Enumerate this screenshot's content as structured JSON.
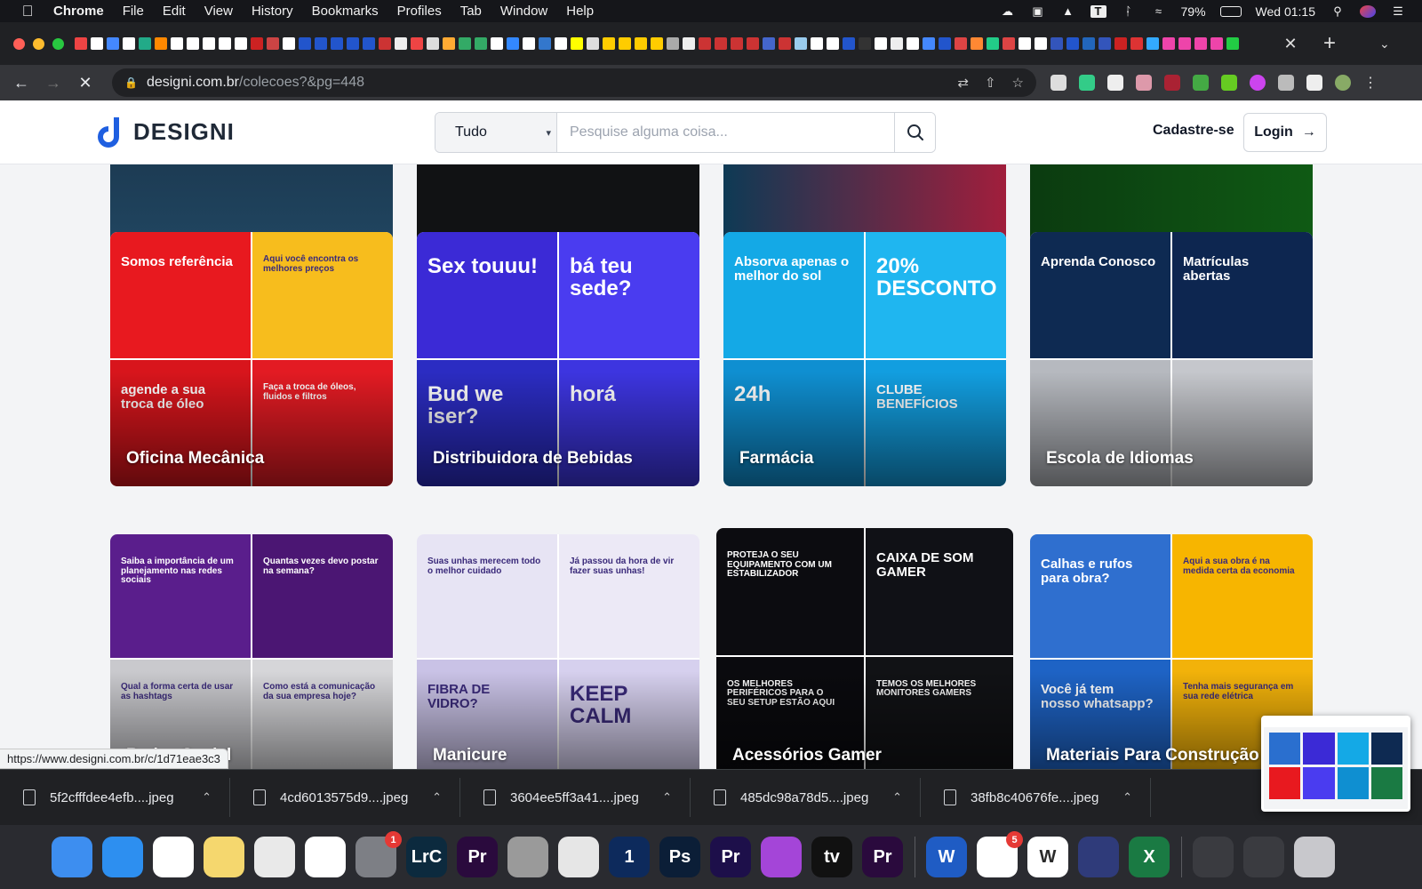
{
  "menubar": {
    "app": "Chrome",
    "items": [
      "File",
      "Edit",
      "View",
      "History",
      "Bookmarks",
      "Profiles",
      "Tab",
      "Window",
      "Help"
    ],
    "battery": "79%",
    "clock": "Wed 01:15"
  },
  "browser": {
    "url_host": "designi.com.br",
    "url_path": "/colecoes?&pg=448",
    "status_url": "https://www.designi.com.br/c/1d71eae3c3"
  },
  "site": {
    "logo_text": "DESIGNI",
    "search_category": "Tudo",
    "search_placeholder": "Pesquise alguma coisa...",
    "signup": "Cadastre-se",
    "login": "Login"
  },
  "collections": [
    {
      "title": "Oficina Mecânica",
      "colors": [
        "#e8191f",
        "#f7bd1d",
        "#d8151c",
        "#e31b23"
      ],
      "texts": [
        "Somos referência",
        "Aqui você encontra os melhores preços",
        "agende a sua troca de óleo",
        "Faça a troca de óleos, fluidos e filtros"
      ]
    },
    {
      "title": "Distribuidora de Bebidas",
      "colors": [
        "#3b2ad6",
        "#4a3cf0",
        "#2b2cc2",
        "#3d35e0"
      ],
      "texts": [
        "Sex touuu!",
        "bá teu sede?",
        "Bud we iser?",
        "horá"
      ]
    },
    {
      "title": "Farmácia",
      "colors": [
        "#14a9e6",
        "#1fb6f0",
        "#0f8fd1",
        "#129ee0"
      ],
      "texts": [
        "Absorva apenas o melhor do sol",
        "20% DESCONTO",
        "24h",
        "CLUBE BENEFÍCIOS"
      ]
    },
    {
      "title": "Escola de Idiomas",
      "colors": [
        "#0e2a52",
        "#0d2650",
        "#b6b9bf",
        "#c5c7cc"
      ],
      "texts": [
        "Aprenda Conosco",
        "Matrículas abertas",
        "",
        ""
      ]
    },
    {
      "title": "Redes Social",
      "colors": [
        "#5a1e8c",
        "#4b1673",
        "#c9c9cd",
        "#d6d6d9"
      ],
      "texts": [
        "Saiba a importância de um planejamento nas redes sociais",
        "Quantas vezes devo postar na semana?",
        "Qual a forma certa de usar as hashtags",
        "Como está a comunicação da sua empresa hoje?"
      ]
    },
    {
      "title": "Manicure",
      "colors": [
        "#e7e4f4",
        "#ece9f6",
        "#c9c2e6",
        "#d6d0ee"
      ],
      "texts": [
        "Suas unhas merecem todo o melhor cuidado",
        "Já passou da hora de vir fazer suas unhas!",
        "FIBRA DE VIDRO?",
        "KEEP CALM"
      ]
    },
    {
      "title": "Acessórios Gamer",
      "colors": [
        "#0c0c10",
        "#101116",
        "#0a0a0e",
        "#111215"
      ],
      "texts": [
        "PROTEJA O SEU EQUIPAMENTO COM UM ESTABILIZADOR",
        "CAIXA DE SOM GAMER",
        "OS MELHORES PERIFÉRICOS PARA O SEU SETUP ESTÃO AQUI",
        "TEMOS OS MELHORES MONITORES GAMERS"
      ]
    },
    {
      "title": "Materiais Para Construção",
      "colors": [
        "#2f6fcf",
        "#f7b500",
        "#1e63c5",
        "#f2b20a"
      ],
      "texts": [
        "Calhas e rufos para obra?",
        "Aqui a sua obra é na medida certa da economia",
        "Você já tem nosso whatsapp?",
        "Tenha mais segurança em sua rede elétrica"
      ]
    }
  ],
  "downloads": [
    "5f2cfffdee4efb....jpeg",
    "4cd6013575d9....jpeg",
    "3604ee5ff3a41....jpeg",
    "485dc98a78d5....jpeg",
    "38fb8c40676fe....jpeg"
  ],
  "dock": [
    {
      "name": "finder",
      "color": "#3d8ef0",
      "label": ""
    },
    {
      "name": "safari",
      "color": "#2d8ff0",
      "label": ""
    },
    {
      "name": "chrome",
      "color": "#ffffff",
      "label": ""
    },
    {
      "name": "notes",
      "color": "#f5d76e",
      "label": ""
    },
    {
      "name": "textedit",
      "color": "#e9e9e9",
      "label": ""
    },
    {
      "name": "photos",
      "color": "#ffffff",
      "label": ""
    },
    {
      "name": "system-preferences",
      "color": "#7d7f85",
      "label": "",
      "badge": "1"
    },
    {
      "name": "lightroom-classic",
      "color": "#0c2a3e",
      "label": "LrC"
    },
    {
      "name": "premiere-pro",
      "color": "#2a0a3d",
      "label": "Pr"
    },
    {
      "name": "no-entry-app",
      "color": "#9a9a9a",
      "label": ""
    },
    {
      "name": "preview",
      "color": "#e6e6e6",
      "label": ""
    },
    {
      "name": "1password",
      "color": "#0d2a5c",
      "label": "1"
    },
    {
      "name": "photoshop",
      "color": "#0b1e37",
      "label": "Ps"
    },
    {
      "name": "premiere-pro-2",
      "color": "#1d0f4a",
      "label": "Pr"
    },
    {
      "name": "podcasts",
      "color": "#a445d8",
      "label": ""
    },
    {
      "name": "apple-tv",
      "color": "#111111",
      "label": "tv"
    },
    {
      "name": "premiere-pro-3",
      "color": "#2a0a3d",
      "label": "Pr"
    },
    {
      "name": "word",
      "color": "#1f5cc4",
      "label": "W"
    },
    {
      "name": "microsoft-office",
      "color": "#ffffff",
      "label": "",
      "badge": "5"
    },
    {
      "name": "wrike",
      "color": "#ffffff",
      "label": "W"
    },
    {
      "name": "framer",
      "color": "#2f3b7a",
      "label": ""
    },
    {
      "name": "excel",
      "color": "#1a7a43",
      "label": "X"
    },
    {
      "name": "screenshot-stack",
      "color": "#3a3b40",
      "label": ""
    },
    {
      "name": "downloads-stack",
      "color": "#3a3b40",
      "label": ""
    },
    {
      "name": "trash",
      "color": "#c8c8cc",
      "label": ""
    }
  ]
}
